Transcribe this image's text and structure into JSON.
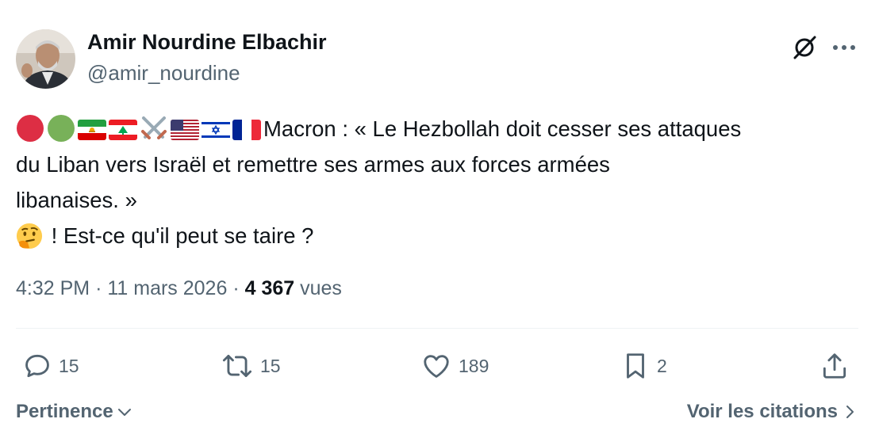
{
  "author": {
    "display_name": "Amir Nourdine Elbachir",
    "handle": "@amir_nourdine"
  },
  "header": {
    "grok_icon": "grok-slash-circle-icon",
    "more_icon": "ellipsis-icon"
  },
  "tweet": {
    "emoji_prefix": [
      "red-circle",
      "green-circle",
      "flag-iran-lion-sun",
      "flag-lebanon",
      "crossed-swords",
      "flag-usa",
      "flag-israel",
      "flag-france"
    ],
    "line1": "Macron : « Le Hezbollah doit cesser ses attaques",
    "line2": "du Liban vers Israël et remettre ses armes aux forces armées",
    "line3": "libanaises. »",
    "line4_emoji": "thinking-face",
    "line4": " ! Est-ce qu'il peut se taire ?"
  },
  "meta": {
    "time": "4:32 PM",
    "separator": "·",
    "date": "11 mars 2026",
    "views_count": "4 367",
    "views_label": "vues"
  },
  "actions": {
    "replies": "15",
    "reposts": "15",
    "likes": "189",
    "bookmarks": "2"
  },
  "footer": {
    "sort_label": "Pertinence",
    "quotes_label": "Voir les citations"
  },
  "colors": {
    "text_primary": "#0f1419",
    "text_secondary": "#536471",
    "divider": "#eff3f4"
  }
}
